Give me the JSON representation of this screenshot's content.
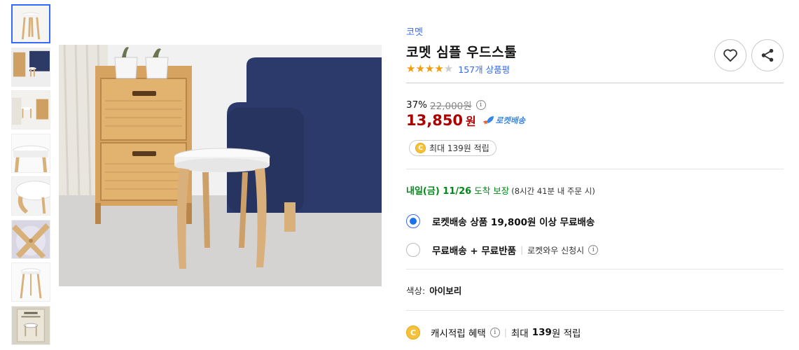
{
  "product": {
    "brand": "코멧",
    "title": "코멧 심플 우드스툴",
    "rating": 4,
    "rating_max": 5,
    "review_count": "157개 상품평",
    "discount_rate": "37%",
    "original_price": "22,000원",
    "sale_price": "13,850",
    "currency": "원",
    "rocket_label": "로켓배송",
    "cash_chip": "최대 139원 적립",
    "coin_symbol": "C"
  },
  "delivery": {
    "arrival": "내일(금) 11/26",
    "arrival_suffix": "도착 보장",
    "arrival_note": "(8시간 41분 내 주문 시)"
  },
  "shipping_options": [
    {
      "label": "로켓배송 상품 19,800원 이상 무료배송",
      "selected": true
    },
    {
      "label": "무료배송 + 무료반품",
      "sub": "로켓와우 신청시",
      "selected": false
    }
  ],
  "color_option": {
    "label": "색상:",
    "value": "아이보리"
  },
  "cash_benefit": {
    "label": "캐시적립 혜택",
    "prefix": "최대",
    "amount": "139",
    "suffix": "원 적립"
  },
  "icons": {
    "wishlist": "heart-icon",
    "share": "share-icon",
    "info": "info-icon"
  },
  "colors": {
    "accent": "#346aff",
    "price": "#ae0000",
    "star": "#f49d0c",
    "delivery_green": "#00891a"
  }
}
